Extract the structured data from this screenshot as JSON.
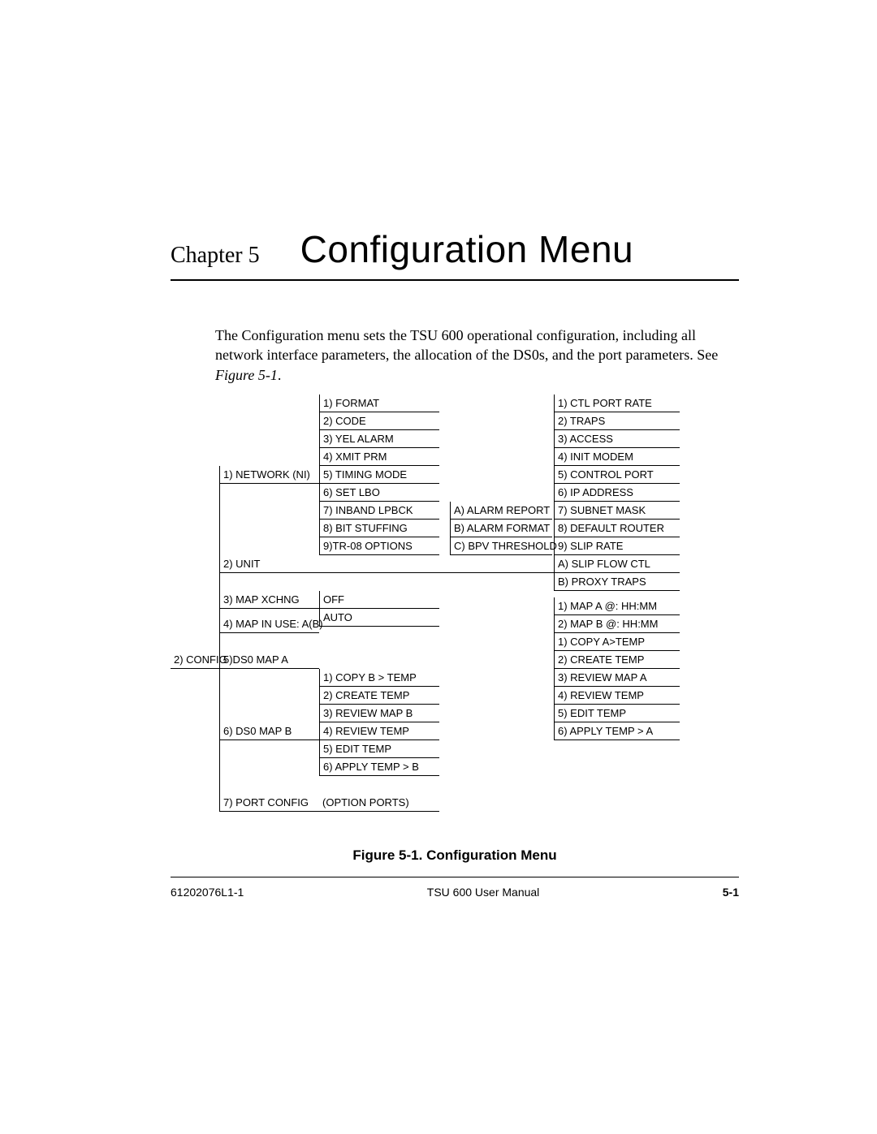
{
  "chapter": {
    "label": "Chapter 5",
    "title": "Configuration Menu"
  },
  "intro": {
    "text_before": "The Configuration menu sets the TSU 600 operational configuration, including all network interface parameters, the allocation of the DS0s, and the port parameters. See ",
    "ref": "Figure 5-1",
    "text_after": "."
  },
  "config_label": "2) CONFIG",
  "colB": [
    "1) NETWORK (NI)",
    "2) UNIT",
    "3) MAP XCHNG",
    "4) MAP IN USE: A(B)",
    "5)DS0 MAP A",
    "6) DS0 MAP B",
    "7) PORT CONFIG"
  ],
  "colC_network": [
    "1) FORMAT",
    "2) CODE",
    "3) YEL ALARM",
    "4) XMIT PRM",
    "5) TIMING MODE",
    "6) SET LBO",
    "7) INBAND LPBCK",
    "8) BIT STUFFING",
    "9)TR-08 OPTIONS"
  ],
  "colC_mapxchng": [
    "OFF",
    "AUTO"
  ],
  "colC_ds0mapb": [
    "1) COPY B > TEMP",
    "2) CREATE TEMP",
    "3) REVIEW MAP B",
    "4) REVIEW TEMP",
    "5) EDIT TEMP",
    "6) APPLY TEMP > B"
  ],
  "colC_portconfig": "(OPTION PORTS)",
  "colD": [
    "A) ALARM REPORT",
    "B) ALARM FORMAT",
    "C) BPV THRESHOLD"
  ],
  "colE_unit": [
    "1) CTL PORT RATE",
    "2) TRAPS",
    "3) ACCESS",
    "4) INIT MODEM",
    "5) CONTROL PORT",
    "6) IP ADDRESS",
    "7) SUBNET MASK",
    "8) DEFAULT ROUTER",
    "9) SLIP RATE",
    "A) SLIP FLOW CTL",
    "B) PROXY TRAPS"
  ],
  "colE_auto": [
    "1) MAP A @: HH:MM",
    "2) MAP B @: HH:MM"
  ],
  "colE_ds0mapa": [
    "1) COPY A>TEMP",
    "2) CREATE TEMP",
    "3) REVIEW MAP A",
    "4) REVIEW TEMP",
    "5) EDIT TEMP",
    "6) APPLY TEMP > A"
  ],
  "figure_caption": "Figure 5-1.  Configuration Menu",
  "footer": {
    "left": "61202076L1-1",
    "center": "TSU 600 User Manual",
    "right": "5-1"
  }
}
